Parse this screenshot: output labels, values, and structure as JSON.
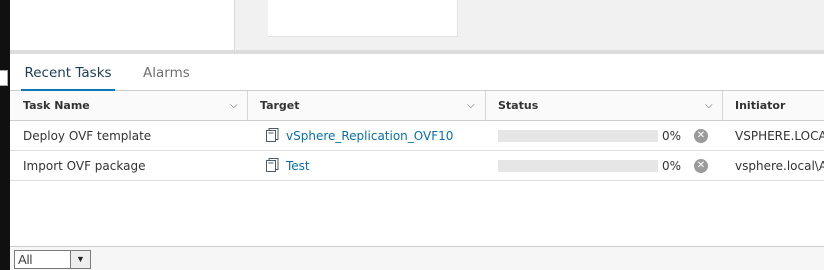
{
  "tabs": [
    {
      "label": "Recent Tasks",
      "active": true
    },
    {
      "label": "Alarms",
      "active": false
    }
  ],
  "columns": [
    {
      "label": "Task Name",
      "icon": "chevron-down-icon"
    },
    {
      "label": "Target",
      "icon": "chevron-down-icon"
    },
    {
      "label": "Status",
      "icon": "chevron-down-icon"
    },
    {
      "label": "Initiator"
    }
  ],
  "rows": [
    {
      "task": "Deploy OVF template",
      "target": "vSphere_Replication_OVF10",
      "target_icon": "vm-template-icon",
      "progress": "0%",
      "initiator": "VSPHERE.LOCA"
    },
    {
      "task": "Import OVF package",
      "target": "Test",
      "target_icon": "vm-template-icon",
      "progress": "0%",
      "initiator": "vsphere.local\\A"
    }
  ],
  "filter": {
    "selected": "All"
  },
  "colors": {
    "accent": "#0a79b6",
    "link": "#0a6fa8"
  }
}
